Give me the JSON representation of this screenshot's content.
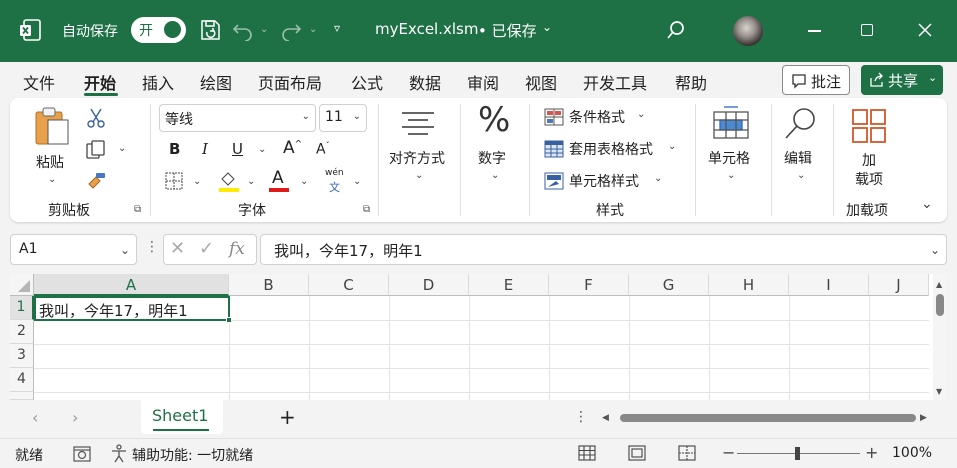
{
  "titlebar": {
    "autosave_label": "自动保存",
    "autosave_state": "开",
    "filename": "myExcel.xlsm",
    "save_status": "• 已保存",
    "accent": "#1e7145"
  },
  "menu": {
    "items": [
      "文件",
      "开始",
      "插入",
      "绘图",
      "页面布局",
      "公式",
      "数据",
      "审阅",
      "视图",
      "开发工具",
      "帮助"
    ],
    "active": "开始",
    "comment_button": "批注",
    "share_button": "共享"
  },
  "ribbon": {
    "clipboard": {
      "paste": "粘贴",
      "group": "剪贴板"
    },
    "font": {
      "name": "等线",
      "size": "11",
      "group": "字体",
      "pinyin": "wén",
      "pinyin_char": "文"
    },
    "alignment": {
      "label": "对齐方式"
    },
    "number": {
      "label": "数字"
    },
    "styles": {
      "conditional": "条件格式",
      "table": "套用表格格式",
      "cell_styles": "单元格样式",
      "group": "样式"
    },
    "cells": {
      "label": "单元格"
    },
    "editing": {
      "label": "编辑"
    },
    "addins": {
      "label_line1": "加",
      "label_line2": "载项",
      "group": "加载项"
    }
  },
  "formula_bar": {
    "name_box": "A1",
    "fx": "fx",
    "content": "我叫，今年17，明年1"
  },
  "grid": {
    "columns": [
      "A",
      "B",
      "C",
      "D",
      "E",
      "F",
      "G",
      "H",
      "I",
      "J"
    ],
    "rows": [
      "1",
      "2",
      "3",
      "4"
    ],
    "cell_a1": "我叫，今年17，明年1"
  },
  "sheets": {
    "tabs": [
      "Sheet1"
    ],
    "add": "+"
  },
  "status": {
    "ready": "就绪",
    "accessibility": "辅助功能: 一切就绪",
    "zoom": "100%",
    "minus": "−",
    "plus": "+"
  }
}
